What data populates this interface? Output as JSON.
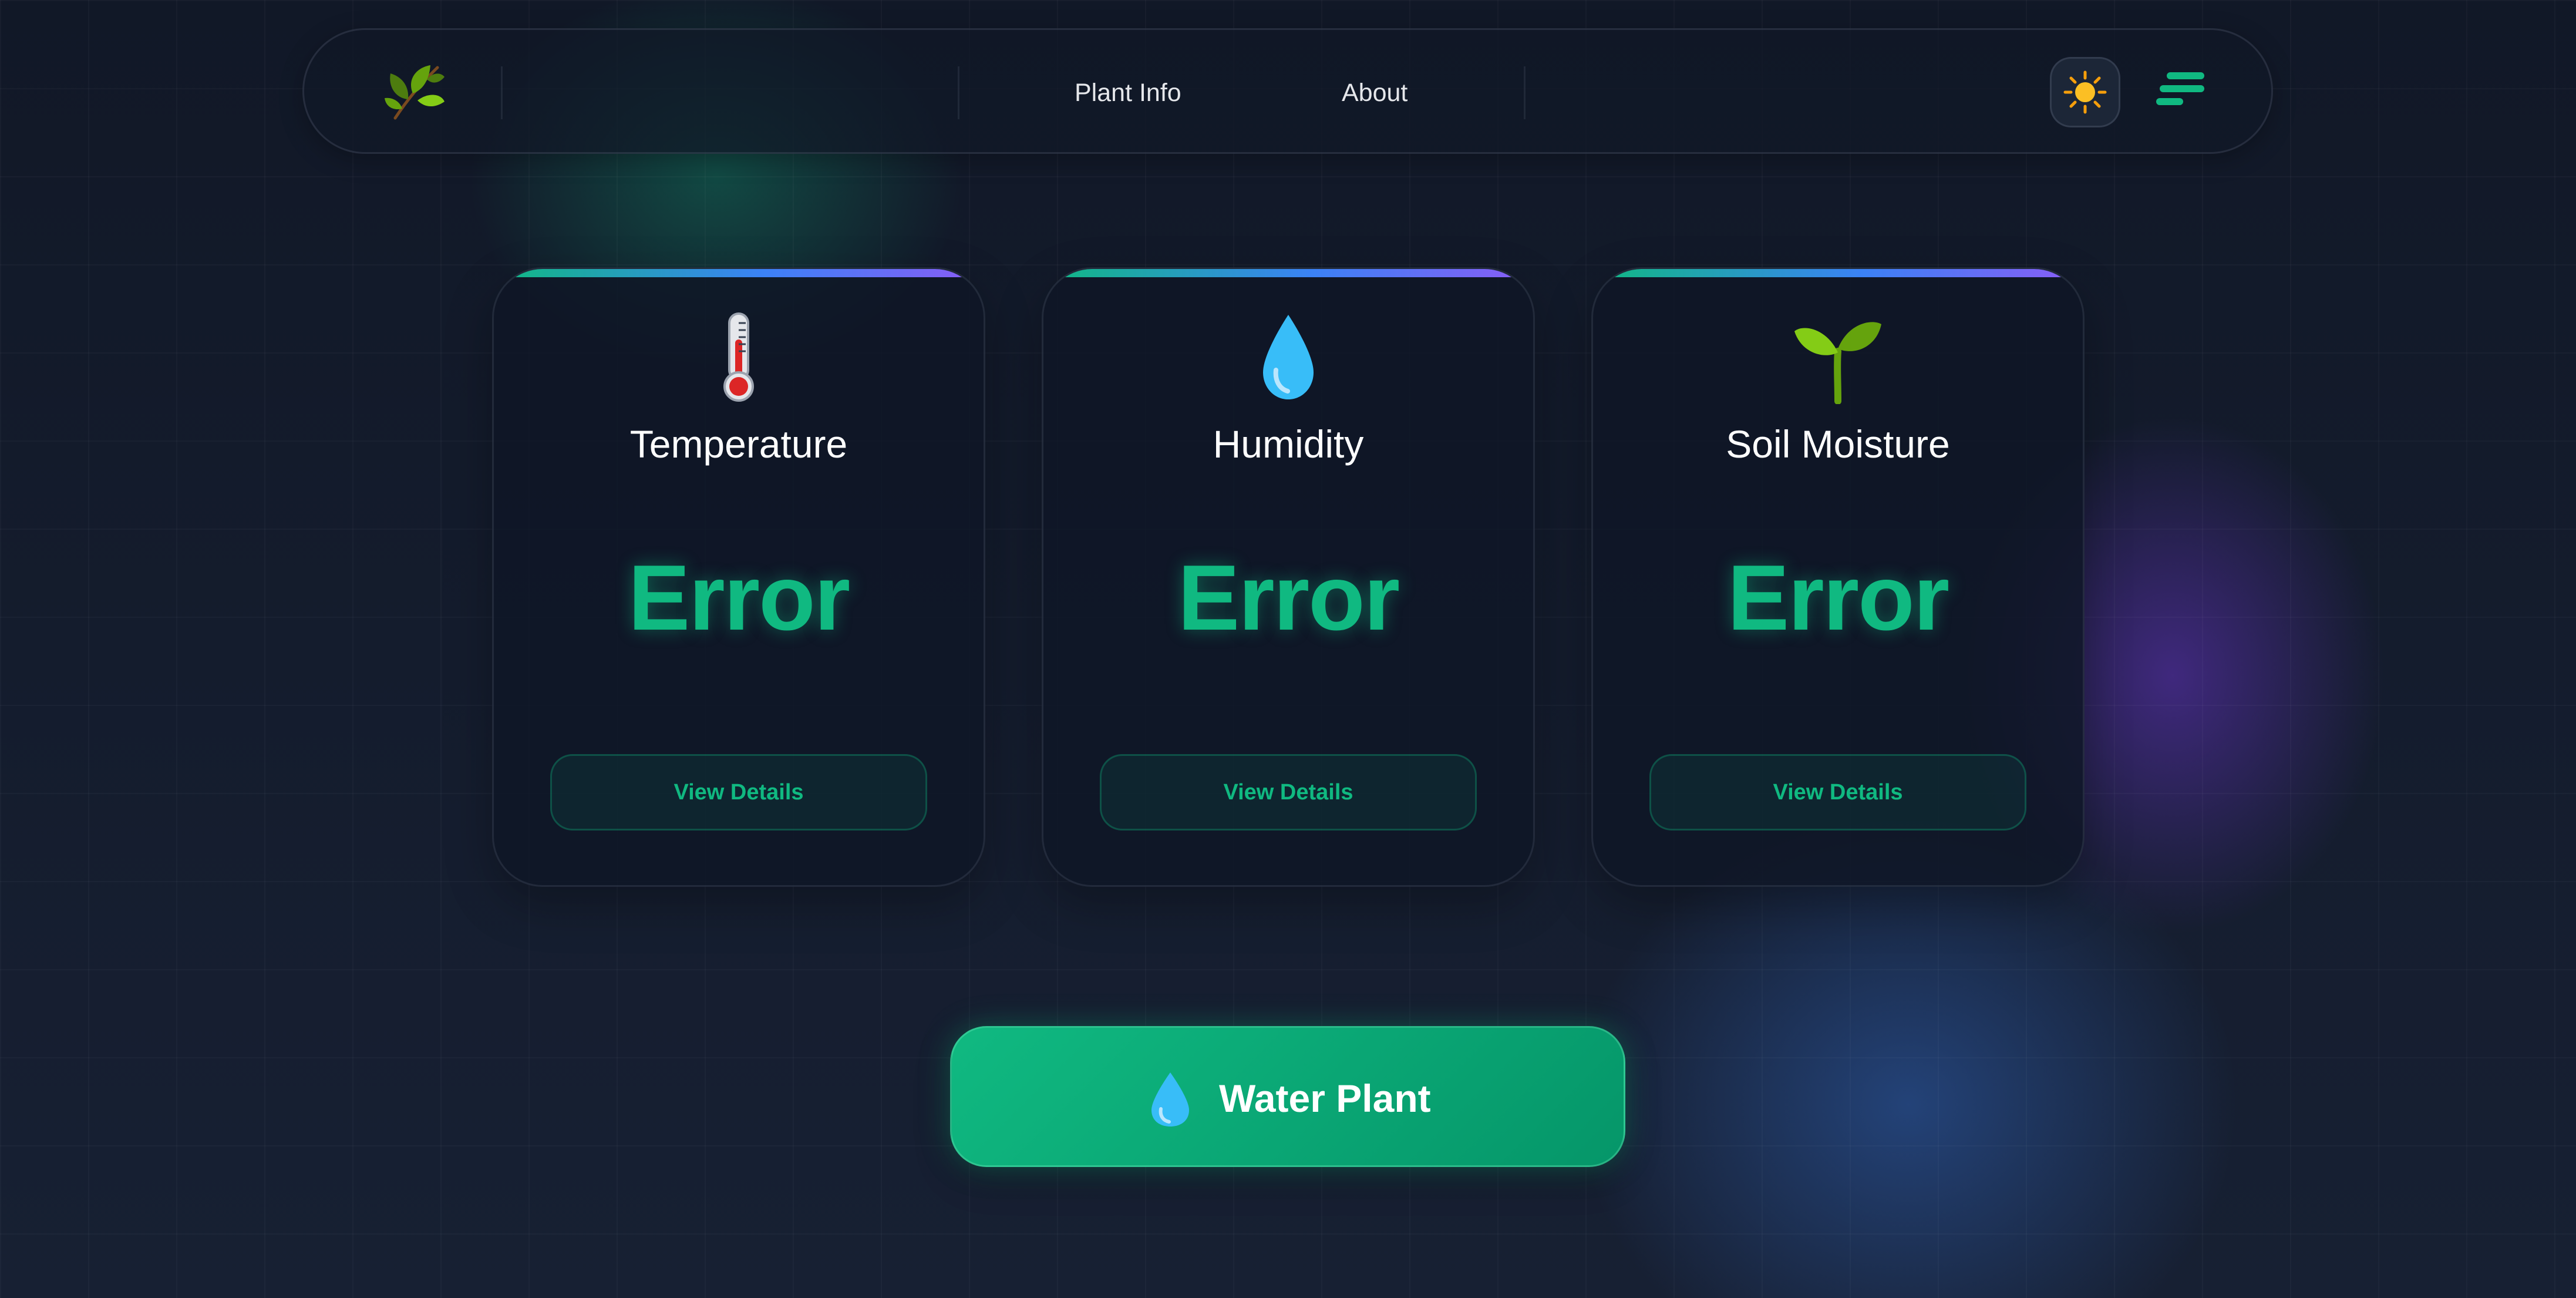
{
  "nav": {
    "logo_icon": "leaf-icon",
    "links": [
      {
        "label": "Plant Info"
      },
      {
        "label": "About"
      }
    ],
    "theme_toggle_icon": "sun-icon",
    "menu_icon": "menu-icon"
  },
  "cards": [
    {
      "icon": "thermometer-icon",
      "title": "Temperature",
      "value": "Error",
      "button_label": "View Details"
    },
    {
      "icon": "water-drop-icon",
      "title": "Humidity",
      "value": "Error",
      "button_label": "View Details"
    },
    {
      "icon": "seedling-icon",
      "title": "Soil Moisture",
      "value": "Error",
      "button_label": "View Details"
    }
  ],
  "water_button": {
    "icon": "water-drop-icon",
    "label": "Water Plant"
  },
  "colors": {
    "accent": "#10b981",
    "accent_dark": "#059669",
    "background": "#161d2c",
    "card_bg": "#0f1626",
    "gradient_blue": "#3b82f6",
    "gradient_purple": "#8b5cf6"
  }
}
